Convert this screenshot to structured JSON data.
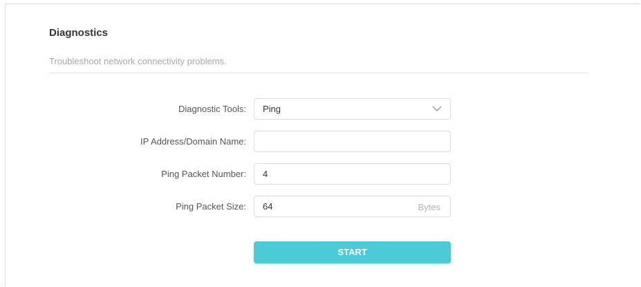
{
  "section": {
    "title": "Diagnostics",
    "subtitle": "Troubleshoot network connectivity problems."
  },
  "form": {
    "diagnostic_tools": {
      "label": "Diagnostic Tools:",
      "selected": "Ping"
    },
    "ip_address": {
      "label": "IP Address/Domain Name:",
      "value": ""
    },
    "ping_packet_number": {
      "label": "Ping Packet Number:",
      "value": "4"
    },
    "ping_packet_size": {
      "label": "Ping Packet Size:",
      "value": "64",
      "unit": "Bytes"
    }
  },
  "actions": {
    "start_label": "START"
  },
  "colors": {
    "accent": "#4acbd6",
    "title_text": "#333333",
    "muted_text": "#a8a8a8",
    "border": "#dcdcdc"
  },
  "icons": {
    "dropdown": "chevron-down-icon"
  }
}
